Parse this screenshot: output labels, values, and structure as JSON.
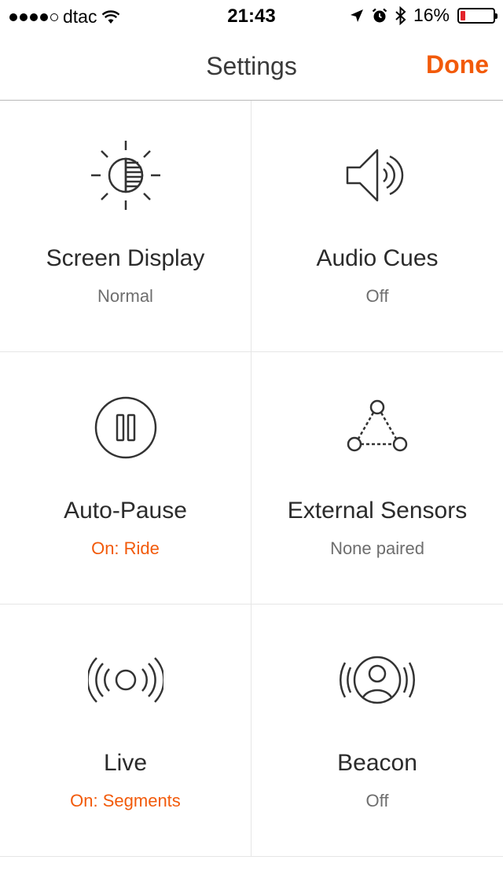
{
  "status_bar": {
    "carrier": "dtac",
    "time": "21:43",
    "battery_percent": "16%",
    "battery_level": 0.16,
    "signal_bars_filled": 4,
    "signal_bars_total": 5,
    "icons": [
      "wifi-icon",
      "location-arrow-icon",
      "alarm-icon",
      "bluetooth-icon",
      "battery-icon"
    ]
  },
  "nav": {
    "title": "Settings",
    "done_label": "Done"
  },
  "colors": {
    "accent": "#f25a0a",
    "battery_low": "#e3242b",
    "text_primary": "#2b2b2b",
    "text_secondary": "#6e6e6e"
  },
  "tiles": [
    {
      "title": "Screen Display",
      "value": "Normal",
      "icon": "brightness-icon",
      "active": false
    },
    {
      "title": "Audio Cues",
      "value": "Off",
      "icon": "speaker-icon",
      "active": false
    },
    {
      "title": "Auto-Pause",
      "value": "On: Ride",
      "icon": "pause-icon",
      "active": true
    },
    {
      "title": "External Sensors",
      "value": "None paired",
      "icon": "sensors-icon",
      "active": false
    },
    {
      "title": "Live",
      "value": "On: Segments",
      "icon": "broadcast-icon",
      "active": true
    },
    {
      "title": "Beacon",
      "value": "Off",
      "icon": "beacon-icon",
      "active": false
    }
  ]
}
